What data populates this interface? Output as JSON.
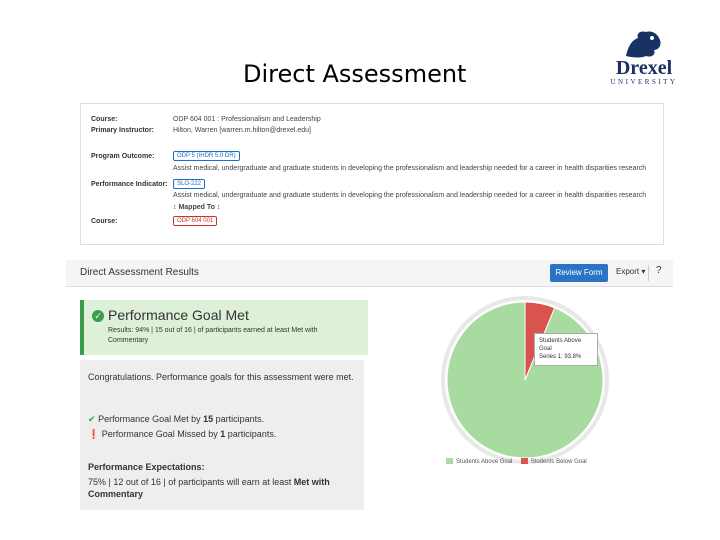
{
  "slide": {
    "title": "Direct Assessment"
  },
  "logo": {
    "wordmark": "Drexel",
    "subtext": "UNIVERSITY"
  },
  "details": {
    "course_label": "Course:",
    "course_value": "ODP 604 001 : Professionalism and Leadership",
    "instructor_label": "Primary Instructor:",
    "instructor_value": "Hilton, Warren [warren.m.hilton@drexel.edu]",
    "program_outcome_label": "Program Outcome:",
    "program_outcome_badge": "ODP 5 (IHDR 5.0 DR)",
    "program_outcome_text": "Assist medical, undergraduate and graduate students in developing the professionalism and leadership needed for a career in health disparities research",
    "indicator_label": "Performance Indicator:",
    "indicator_badge": "SLO-222",
    "indicator_text": "Assist medical, undergraduate and graduate students in developing the professionalism and leadership needed for a career in health disparities research",
    "mapped_to": "Mapped To",
    "course2_label": "Course:",
    "course2_badge": "ODP 604 001"
  },
  "results": {
    "title": "Direct Assessment Results",
    "review_button": "Review Form",
    "export_label": "Export",
    "help_glyph": "?"
  },
  "goal": {
    "heading": "Performance Goal Met",
    "summary": "Results: 94% | 15 out of 16 | of participants earned at least Met with Commentary"
  },
  "message": {
    "congrats": "Congratulations. Performance goals for this assessment were met.",
    "met_line_prefix": "Performance Goal Met by ",
    "met_count": "15",
    "met_line_suffix": " participants.",
    "missed_line_prefix": "Performance Goal Missed by ",
    "missed_count": "1",
    "missed_line_suffix": " participants.",
    "expectations_heading": "Performance Expectations:",
    "expectations_prefix": "75% | 12 out of 16 | of participants will earn at least ",
    "expectations_bold": "Met with Commentary"
  },
  "chart_data": {
    "type": "pie",
    "series": [
      {
        "name": "Series 1",
        "values": [
          93.8,
          6.2
        ]
      }
    ],
    "categories": [
      "Students Above Goal",
      "Students Below Goal"
    ],
    "colors": [
      "#a8dba0",
      "#d9534f"
    ],
    "tooltip": {
      "line1": "Students Above Goal",
      "line2": "Series 1: 93.8%"
    },
    "legend_position": "bottom"
  }
}
